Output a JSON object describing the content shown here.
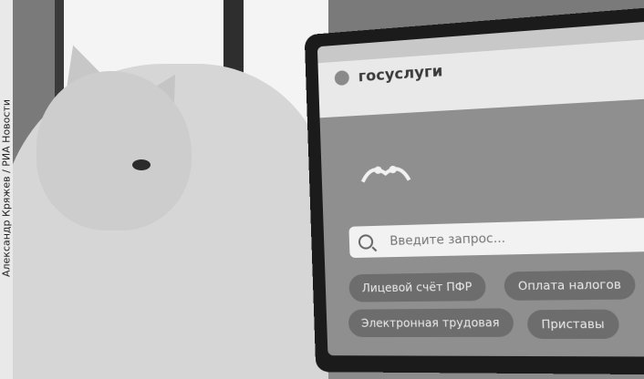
{
  "photo": {
    "credit": "Александр Кряжев / РИА Новости"
  },
  "screen": {
    "site_name": "госуслуги",
    "search": {
      "placeholder": "Введите запрос..."
    },
    "chips": [
      {
        "label": "Лицевой счёт ПФР"
      },
      {
        "label": "Оплата налогов"
      },
      {
        "label": "Электронная трудовая"
      },
      {
        "label": "Приставы"
      }
    ]
  }
}
